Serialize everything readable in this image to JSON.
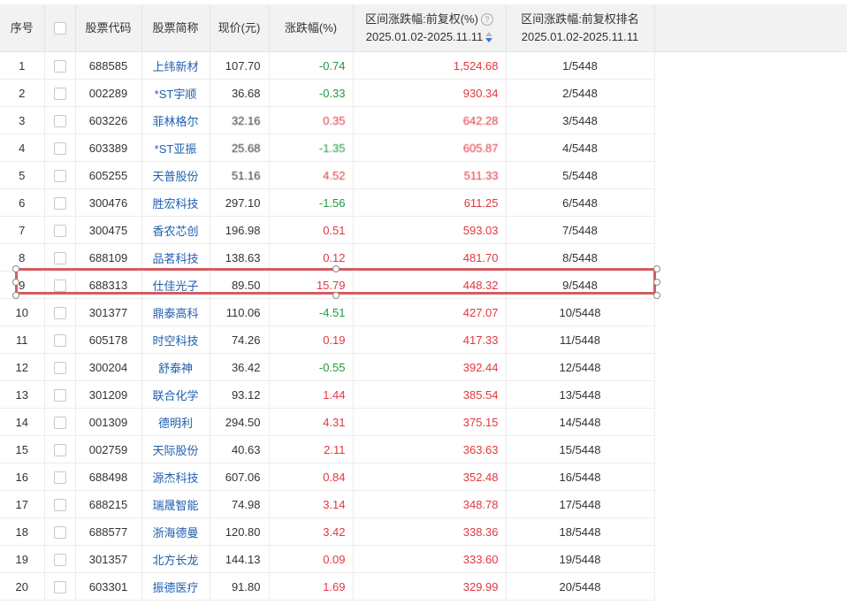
{
  "columns": {
    "index": "序号",
    "code": "股票代码",
    "name": "股票简称",
    "price": "现价(元)",
    "change": "涨跌幅(%)",
    "range_change_line1": "区间涨跌幅:前复权(%)",
    "range_change_line2": "2025.01.02-2025.11.11",
    "range_rank_line1": "区间涨跌幅:前复权排名",
    "range_rank_line2": "2025.01.02-2025.11.11",
    "help_icon": "?"
  },
  "rows": [
    {
      "idx": "1",
      "code": "688585",
      "name": "上纬新材",
      "price": "107.70",
      "chg": "-0.74",
      "dir": "down",
      "range": "1,524.68",
      "rank": "1/5448"
    },
    {
      "idx": "2",
      "code": "002289",
      "name": "*ST宇顺",
      "price": "36.68",
      "chg": "-0.33",
      "dir": "down",
      "range": "930.34",
      "rank": "2/5448"
    },
    {
      "idx": "3",
      "code": "603226",
      "name": "菲林格尔",
      "price": "32.16",
      "chg": "0.35",
      "dir": "up",
      "range": "642.28",
      "rank": "3/5448"
    },
    {
      "idx": "4",
      "code": "603389",
      "name": "*ST亚振",
      "price": "25.68",
      "chg": "-1.35",
      "dir": "down",
      "range": "605.87",
      "rank": "4/5448"
    },
    {
      "idx": "5",
      "code": "605255",
      "name": "天普股份",
      "price": "51.16",
      "chg": "4.52",
      "dir": "up",
      "range": "511.33",
      "rank": "5/5448"
    },
    {
      "idx": "6",
      "code": "300476",
      "name": "胜宏科技",
      "price": "297.10",
      "chg": "-1.56",
      "dir": "down",
      "range": "611.25",
      "rank": "6/5448"
    },
    {
      "idx": "7",
      "code": "300475",
      "name": "香农芯创",
      "price": "196.98",
      "chg": "0.51",
      "dir": "up",
      "range": "593.03",
      "rank": "7/5448"
    },
    {
      "idx": "8",
      "code": "688109",
      "name": "品茗科技",
      "price": "138.63",
      "chg": "0.12",
      "dir": "up",
      "range": "481.70",
      "rank": "8/5448"
    },
    {
      "idx": "9",
      "code": "688313",
      "name": "仕佳光子",
      "price": "89.50",
      "chg": "15.79",
      "dir": "up",
      "range": "448.32",
      "rank": "9/5448"
    },
    {
      "idx": "10",
      "code": "301377",
      "name": "鼎泰高科",
      "price": "110.06",
      "chg": "-4.51",
      "dir": "down",
      "range": "427.07",
      "rank": "10/5448"
    },
    {
      "idx": "11",
      "code": "605178",
      "name": "时空科技",
      "price": "74.26",
      "chg": "0.19",
      "dir": "up",
      "range": "417.33",
      "rank": "11/5448"
    },
    {
      "idx": "12",
      "code": "300204",
      "name": "舒泰神",
      "price": "36.42",
      "chg": "-0.55",
      "dir": "down",
      "range": "392.44",
      "rank": "12/5448"
    },
    {
      "idx": "13",
      "code": "301209",
      "name": "联合化学",
      "price": "93.12",
      "chg": "1.44",
      "dir": "up",
      "range": "385.54",
      "rank": "13/5448"
    },
    {
      "idx": "14",
      "code": "001309",
      "name": "德明利",
      "price": "294.50",
      "chg": "4.31",
      "dir": "up",
      "range": "375.15",
      "rank": "14/5448"
    },
    {
      "idx": "15",
      "code": "002759",
      "name": "天际股份",
      "price": "40.63",
      "chg": "2.11",
      "dir": "up",
      "range": "363.63",
      "rank": "15/5448"
    },
    {
      "idx": "16",
      "code": "688498",
      "name": "源杰科技",
      "price": "607.06",
      "chg": "0.84",
      "dir": "up",
      "range": "352.48",
      "rank": "16/5448"
    },
    {
      "idx": "17",
      "code": "688215",
      "name": "瑞晟智能",
      "price": "74.98",
      "chg": "3.14",
      "dir": "up",
      "range": "348.78",
      "rank": "17/5448"
    },
    {
      "idx": "18",
      "code": "688577",
      "name": "浙海德曼",
      "price": "120.80",
      "chg": "3.42",
      "dir": "up",
      "range": "338.36",
      "rank": "18/5448"
    },
    {
      "idx": "19",
      "code": "301357",
      "name": "北方长龙",
      "price": "144.13",
      "chg": "0.09",
      "dir": "up",
      "range": "333.60",
      "rank": "19/5448"
    },
    {
      "idx": "20",
      "code": "603301",
      "name": "振德医疗",
      "price": "91.80",
      "chg": "1.69",
      "dir": "up",
      "range": "329.99",
      "rank": "20/5448"
    }
  ],
  "colors": {
    "up": "#e0383e",
    "down": "#1e9a3a",
    "name_link": "#1f5fae",
    "selection": "#d45d63"
  },
  "icons": {
    "help": "question-circle-icon",
    "sort": "sort-desc-icon"
  }
}
